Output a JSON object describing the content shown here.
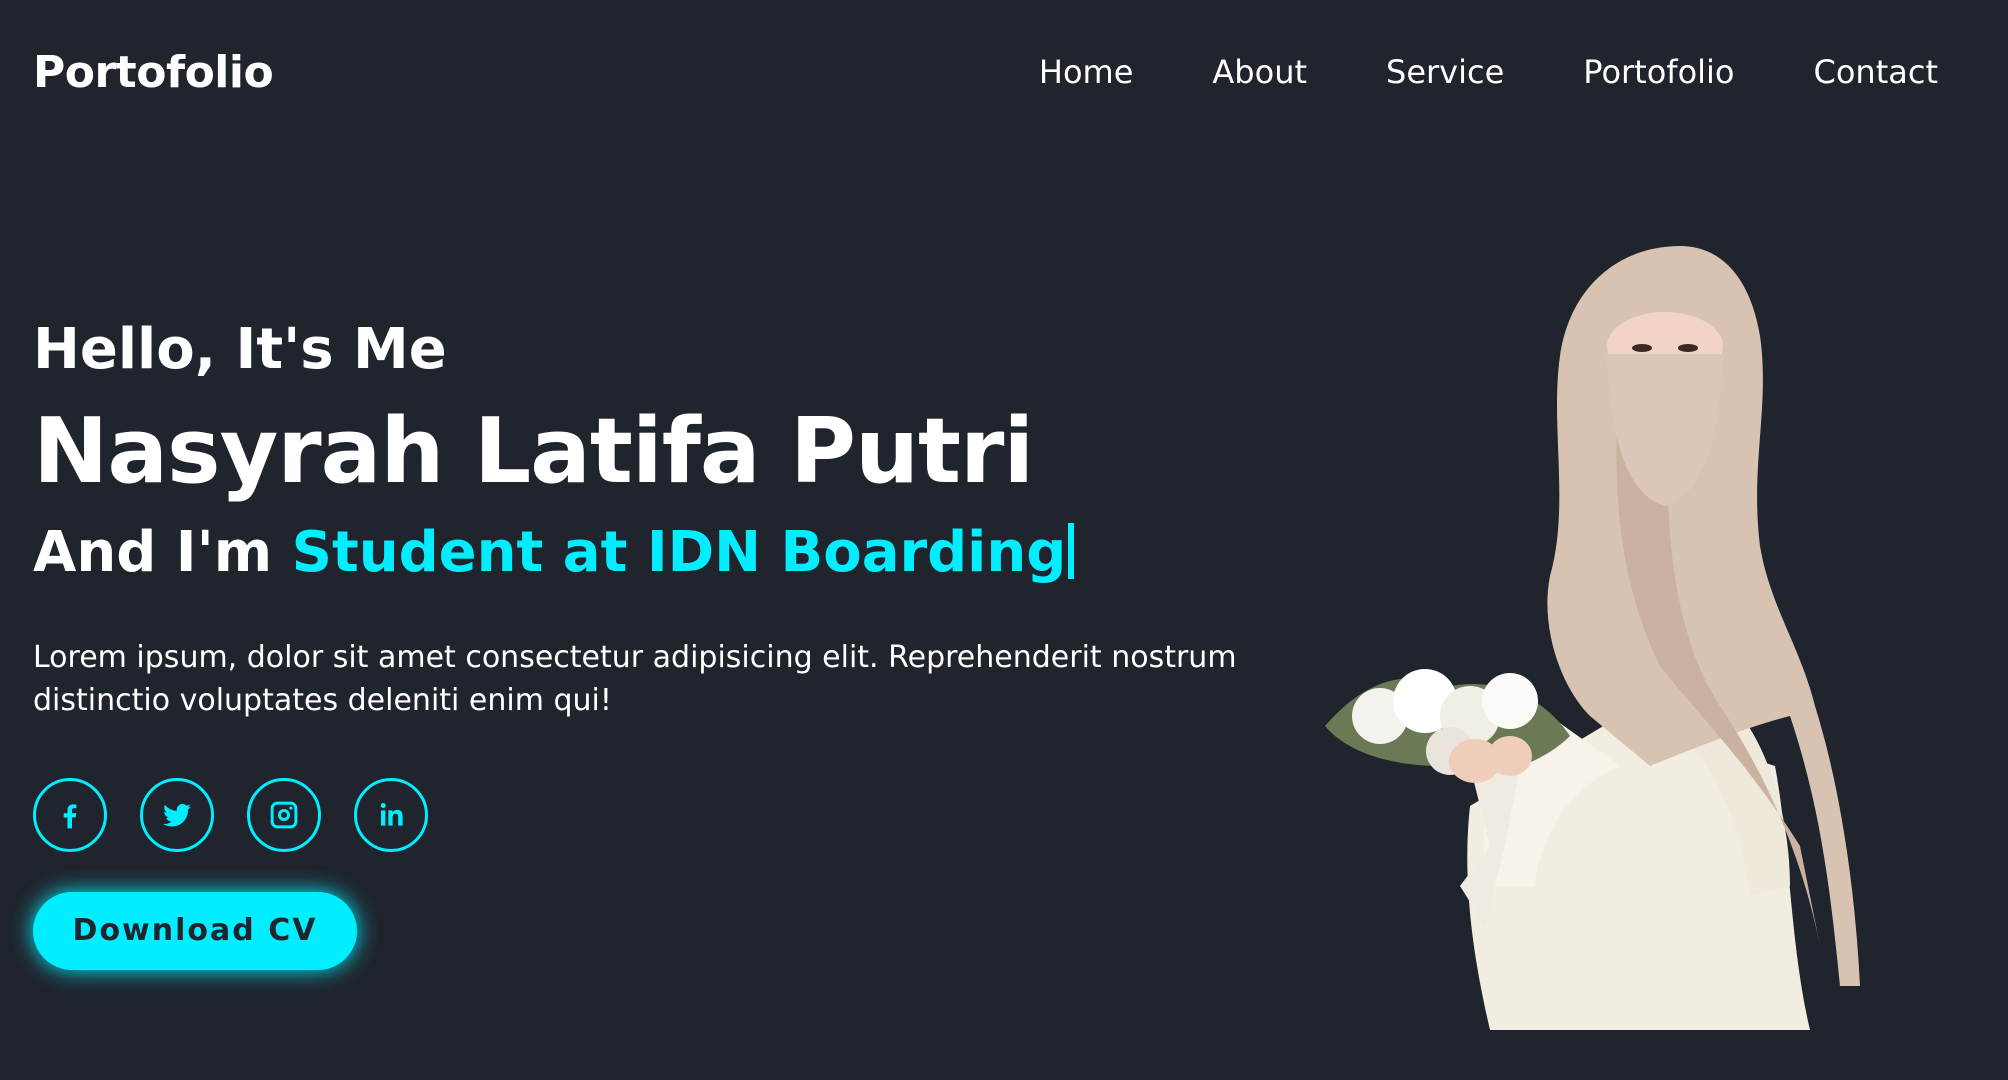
{
  "header": {
    "logo": "Portofolio",
    "nav": [
      {
        "label": "Home"
      },
      {
        "label": "About"
      },
      {
        "label": "Service"
      },
      {
        "label": "Portofolio"
      },
      {
        "label": "Contact"
      }
    ]
  },
  "home": {
    "greeting": "Hello, It's Me",
    "name": "Nasyrah Latifa Putri",
    "role_prefix": "And I'm ",
    "role_highlight": "Student at IDN Boarding",
    "description": "Lorem ipsum, dolor sit amet consectetur adipisicing elit. Reprehenderit nostrum distinctio voluptates deleniti enim qui!",
    "social": [
      {
        "icon": "facebook-icon"
      },
      {
        "icon": "twitter-icon"
      },
      {
        "icon": "instagram-icon"
      },
      {
        "icon": "linkedin-icon"
      }
    ],
    "cta_label": "Download CV"
  },
  "colors": {
    "background": "#1f242d",
    "accent": "#00eeff",
    "text": "#ffffff"
  }
}
